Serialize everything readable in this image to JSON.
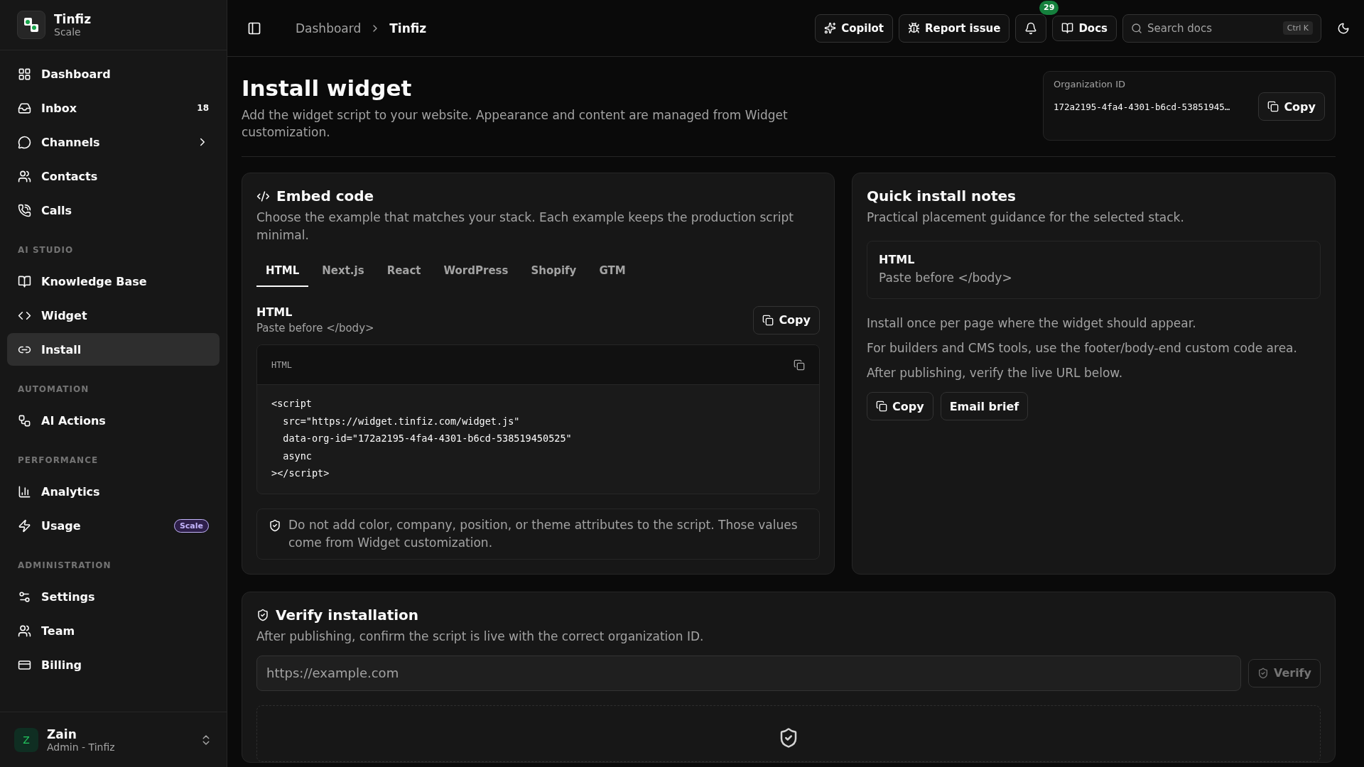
{
  "brand": {
    "name": "Tinfiz",
    "plan": "Scale"
  },
  "sidebar": {
    "sections": [
      {
        "items": [
          {
            "label": "Dashboard",
            "selected": false
          },
          {
            "label": "Inbox",
            "count": "18",
            "selected": false
          },
          {
            "label": "Channels",
            "chevron": true,
            "selected": false
          },
          {
            "label": "Contacts",
            "selected": false
          },
          {
            "label": "Calls",
            "selected": false
          }
        ]
      },
      {
        "heading": "AI STUDIO",
        "items": [
          {
            "label": "Knowledge Base",
            "selected": false
          },
          {
            "label": "Widget",
            "selected": false
          },
          {
            "label": "Install",
            "selected": true
          }
        ]
      },
      {
        "heading": "AUTOMATION",
        "items": [
          {
            "label": "AI Actions",
            "selected": false
          }
        ]
      },
      {
        "heading": "PERFORMANCE",
        "items": [
          {
            "label": "Analytics",
            "selected": false
          },
          {
            "label": "Usage",
            "badge": "Scale",
            "selected": false
          }
        ]
      },
      {
        "heading": "ADMINISTRATION",
        "items": [
          {
            "label": "Settings",
            "selected": false
          },
          {
            "label": "Team",
            "selected": false
          },
          {
            "label": "Billing",
            "selected": false
          }
        ]
      }
    ]
  },
  "user": {
    "initial": "Z",
    "name": "Zain",
    "role": "Admin - Tinfiz"
  },
  "breadcrumb": [
    "Dashboard",
    "Tinfiz"
  ],
  "topbar": {
    "copilot": "Copilot",
    "report": "Report issue",
    "notifications": "29",
    "docs": "Docs",
    "search_placeholder": "Search docs",
    "shortcut": "Ctrl K"
  },
  "page": {
    "title": "Install widget",
    "subtitle": "Add the widget script to your website. Appearance and content are managed from Widget customization.",
    "org_label": "Organization ID",
    "org_id": "172a2195-4fa4-4301-b6cd-53851945…",
    "copy": "Copy"
  },
  "embed": {
    "title": "Embed code",
    "description": "Choose the example that matches your stack. Each example keeps the production script minimal.",
    "tabs": [
      {
        "label": "HTML",
        "selected": true
      },
      {
        "label": "Next.js",
        "selected": false
      },
      {
        "label": "React",
        "selected": false
      },
      {
        "label": "WordPress",
        "selected": false
      },
      {
        "label": "Shopify",
        "selected": false
      },
      {
        "label": "GTM",
        "selected": false
      }
    ],
    "snippet_title": "HTML",
    "snippet_hint": "Paste before </body>",
    "copy": "Copy",
    "code_lang": "HTML",
    "code_lines": [
      "<script",
      "  src=\"https://widget.tinfiz.com/widget.js\"",
      "  data-org-id=\"172a2195-4fa4-4301-b6cd-538519450525\"",
      "  async",
      "></script>"
    ],
    "note": "Do not add color, company, position, or theme attributes to the script. Those values come from Widget customization."
  },
  "notes": {
    "title": "Quick install notes",
    "description": "Practical placement guidance for the selected stack.",
    "box_title": "HTML",
    "box_text": "Paste before </body>",
    "lines": [
      "Install once per page where the widget should appear.",
      "For builders and CMS tools, use the footer/body-end custom code area.",
      "After publishing, verify the live URL below."
    ],
    "copy": "Copy",
    "email": "Email brief"
  },
  "verify": {
    "title": "Verify installation",
    "description": "After publishing, confirm the script is live with the correct organization ID.",
    "placeholder": "https://example.com",
    "button": "Verify",
    "disabled": true
  }
}
